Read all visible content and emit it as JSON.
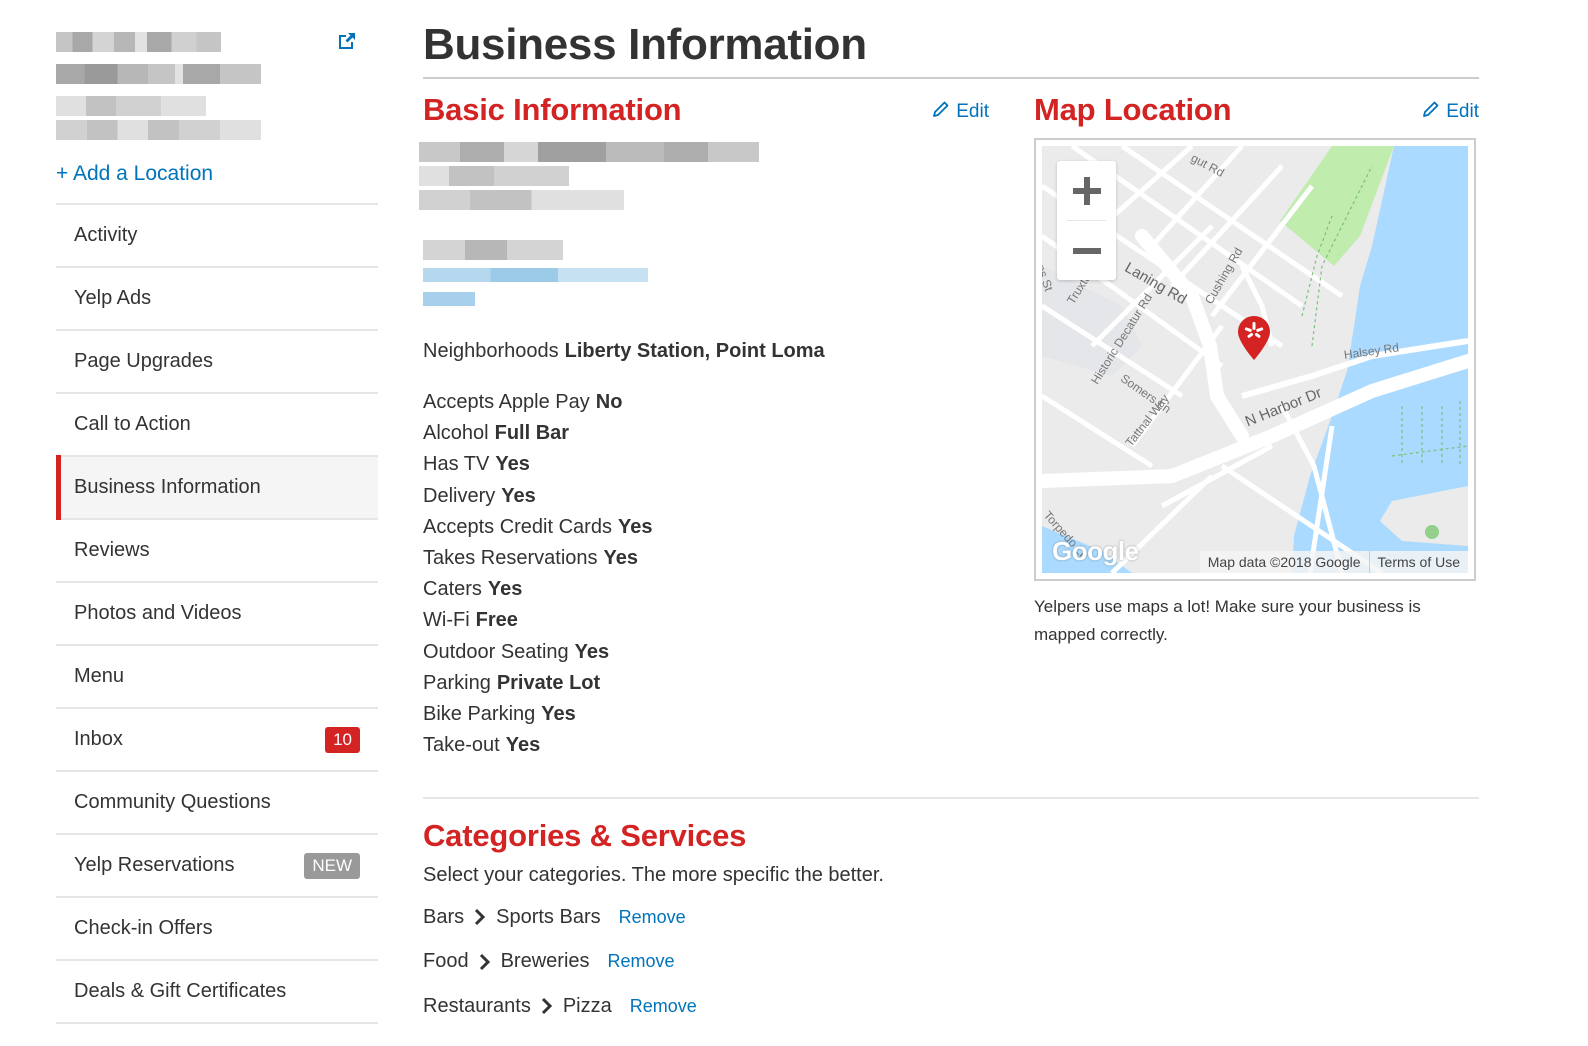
{
  "sidebar": {
    "business_name_redacted": true,
    "add_location_label": "+ Add a Location",
    "items": [
      {
        "label": "Activity"
      },
      {
        "label": "Yelp Ads"
      },
      {
        "label": "Page Upgrades"
      },
      {
        "label": "Call to Action"
      },
      {
        "label": "Business Information",
        "active": true
      },
      {
        "label": "Reviews"
      },
      {
        "label": "Photos and Videos"
      },
      {
        "label": "Menu"
      },
      {
        "label": "Inbox",
        "badge": "10"
      },
      {
        "label": "Community Questions"
      },
      {
        "label": "Yelp Reservations",
        "tag": "NEW"
      },
      {
        "label": "Check-in Offers"
      },
      {
        "label": "Deals & Gift Certificates"
      }
    ]
  },
  "header": {
    "title": "Business Information"
  },
  "basic_info": {
    "heading": "Basic Information",
    "edit_label": "Edit",
    "neighborhoods_label": "Neighborhoods",
    "neighborhoods_value": "Liberty Station, Point Loma",
    "attributes": [
      {
        "label": "Accepts Apple Pay",
        "value": "No"
      },
      {
        "label": "Alcohol",
        "value": "Full Bar"
      },
      {
        "label": "Has TV",
        "value": "Yes"
      },
      {
        "label": "Delivery",
        "value": "Yes"
      },
      {
        "label": "Accepts Credit Cards",
        "value": "Yes"
      },
      {
        "label": "Takes Reservations",
        "value": "Yes"
      },
      {
        "label": "Caters",
        "value": "Yes"
      },
      {
        "label": "Wi-Fi",
        "value": "Free"
      },
      {
        "label": "Outdoor Seating",
        "value": "Yes"
      },
      {
        "label": "Parking",
        "value": "Private Lot"
      },
      {
        "label": "Bike Parking",
        "value": "Yes"
      },
      {
        "label": "Take-out",
        "value": "Yes"
      }
    ]
  },
  "map_location": {
    "heading": "Map Location",
    "edit_label": "Edit",
    "zoom_in": "+",
    "zoom_out": "−",
    "street_labels": [
      "gut Rd",
      "Laning Rd",
      "Cushing Rd",
      "Historic Decatur Rd",
      "Somers Ln",
      "Tattnal Way",
      "N Harbor Dr",
      "Halsey Rd",
      "Torpedo Ln",
      "Truxtun",
      "ns St"
    ],
    "google_logo": "Google",
    "map_data": "Map data ©2018 Google",
    "terms": "Terms of Use",
    "note": "Yelpers use maps a lot! Make sure your business is mapped correctly.",
    "colors": {
      "water": "#aadaff",
      "park": "#c0ecae",
      "land": "#ebebeb",
      "pin": "#d32323"
    }
  },
  "categories": {
    "heading": "Categories & Services",
    "description": "Select your categories. The more specific the better.",
    "remove_label": "Remove",
    "items": [
      {
        "parent": "Bars",
        "child": "Sports Bars"
      },
      {
        "parent": "Food",
        "child": "Breweries"
      },
      {
        "parent": "Restaurants",
        "child": "Pizza"
      }
    ]
  },
  "colors": {
    "brand_red": "#d32323",
    "link_blue": "#0073bb",
    "text": "#333333"
  }
}
